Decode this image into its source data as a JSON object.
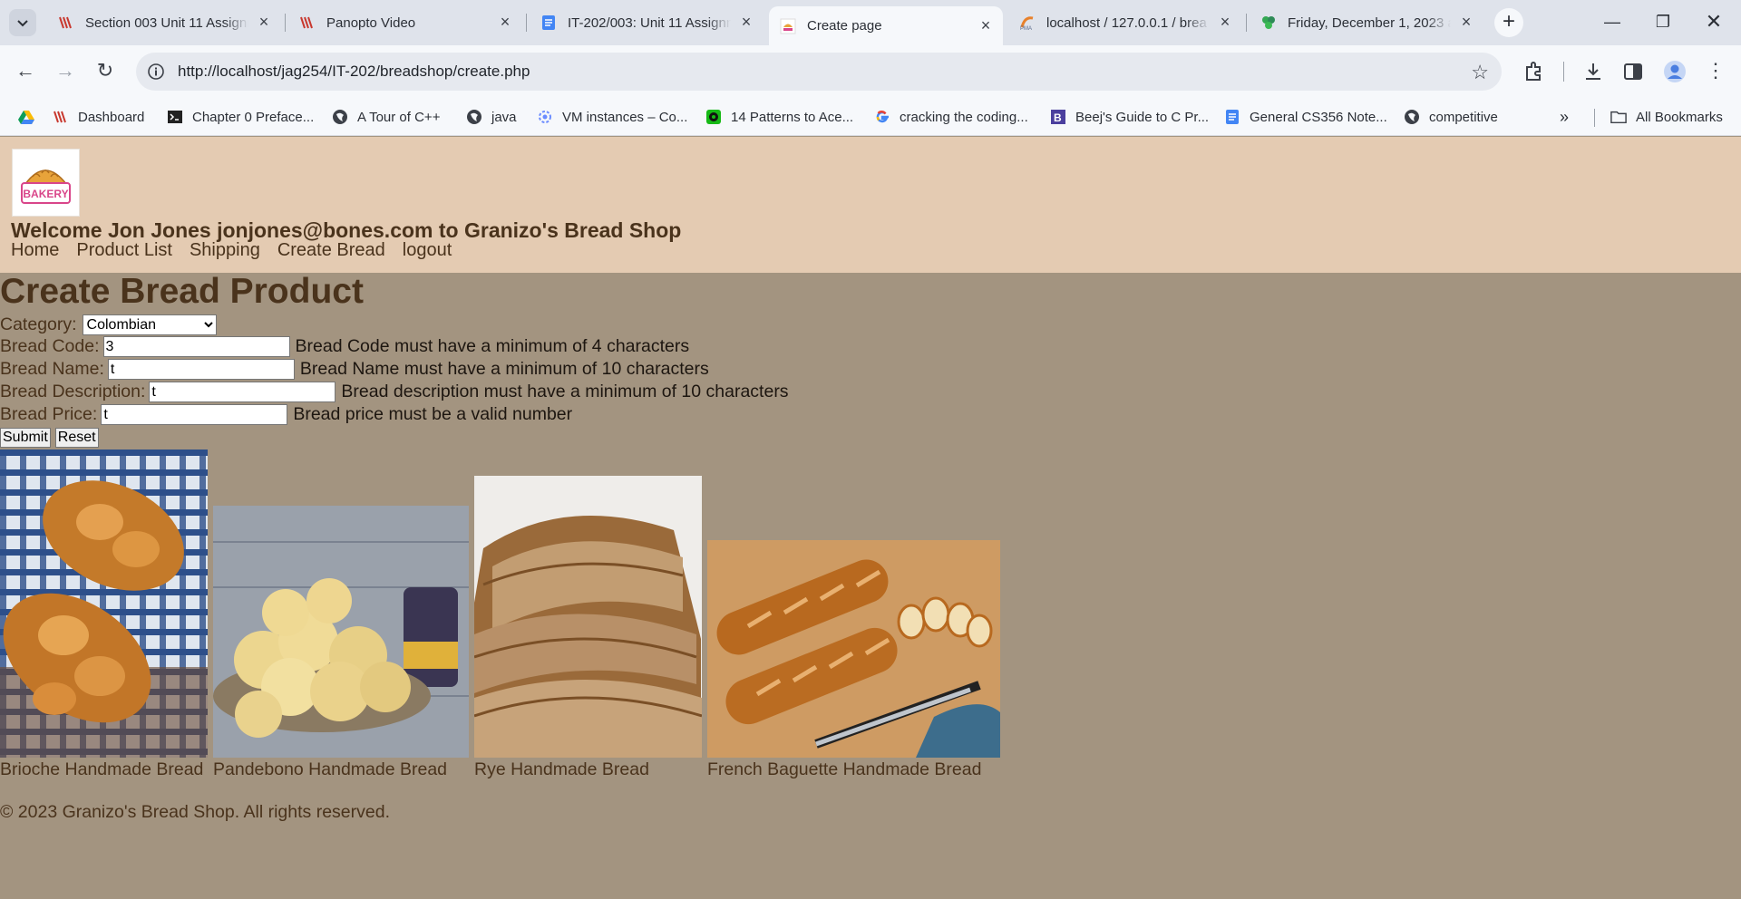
{
  "browser": {
    "tabs": [
      {
        "title": "Section 003 Unit 11 Assignm",
        "icon": "canvas-icon"
      },
      {
        "title": "Panopto Video",
        "icon": "canvas-icon"
      },
      {
        "title": "IT-202/003: Unit 11 Assignm",
        "icon": "docs-icon"
      },
      {
        "title": "Create page",
        "icon": "bakery-icon",
        "active": true
      },
      {
        "title": "localhost / 127.0.0.1 / brea",
        "icon": "phpmyadmin-icon"
      },
      {
        "title": "Friday, December 1, 2023 a",
        "icon": "clover-icon"
      }
    ],
    "url": "http://localhost/jag254/IT-202/breadshop/create.php",
    "bookmarks": [
      {
        "label": "",
        "icon": "drive-icon"
      },
      {
        "label": "Dashboard",
        "icon": "canvas-icon"
      },
      {
        "label": "Chapter 0 Preface...",
        "icon": "terminal-icon"
      },
      {
        "label": "A Tour of C++",
        "icon": "globe-icon"
      },
      {
        "label": "java",
        "icon": "globe-icon"
      },
      {
        "label": "VM instances – Co...",
        "icon": "gcloud-icon"
      },
      {
        "label": "14 Patterns to Ace...",
        "icon": "grokking-icon"
      },
      {
        "label": "cracking the coding...",
        "icon": "google-icon"
      },
      {
        "label": "Beej's Guide to C Pr...",
        "icon": "beej-icon"
      },
      {
        "label": "General CS356 Note...",
        "icon": "docs-icon"
      },
      {
        "label": "competitive",
        "icon": "globe-icon"
      }
    ],
    "all_bookmarks": "All Bookmarks"
  },
  "site": {
    "logo_text": "BAKERY",
    "welcome": "Welcome Jon Jones jonjones@bones.com to Granizo's Bread Shop",
    "nav": [
      "Home",
      "Product List",
      "Shipping",
      "Create Bread",
      "logout"
    ]
  },
  "form": {
    "heading": "Create Bread Product",
    "category_label": "Category:",
    "category_value": "Colombian",
    "code_label": "Bread Code:",
    "code_value": "3",
    "code_error": "Bread Code must have a minimum of 4 characters",
    "name_label": "Bread Name:",
    "name_value": "t",
    "name_error": "Bread Name must have a minimum of 10 characters",
    "desc_label": "Bread Description:",
    "desc_value": "t",
    "desc_error": "Bread description must have a minimum of 10 characters",
    "price_label": "Bread Price:",
    "price_value": "t",
    "price_error": "Bread price must be a valid number",
    "submit": "Submit",
    "reset": "Reset"
  },
  "products": [
    {
      "caption": "Brioche Handmade Bread"
    },
    {
      "caption": "Pandebono Handmade Bread"
    },
    {
      "caption": "Rye Handmade Bread"
    },
    {
      "caption": "French Baguette Handmade Bread"
    }
  ],
  "footer": "© 2023 Granizo's Bread Shop. All rights reserved."
}
